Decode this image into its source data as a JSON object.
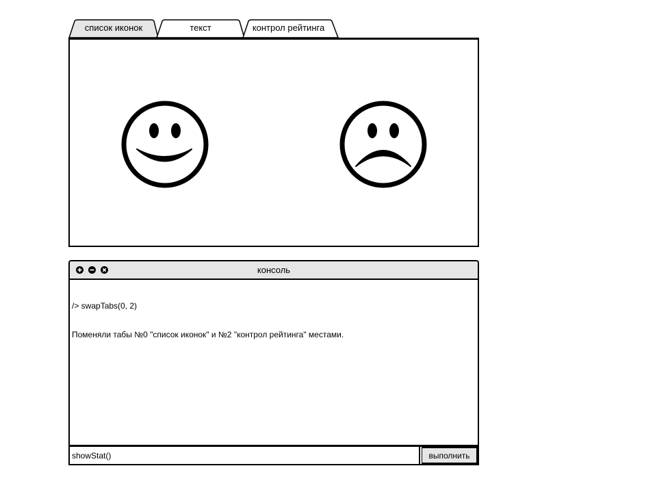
{
  "tabs": [
    {
      "label": "список иконок",
      "active": false,
      "background": "#e6e6e6"
    },
    {
      "label": "текст",
      "active": true,
      "background": "#ffffff"
    },
    {
      "label": "контрол рейтинга",
      "active": false,
      "background": "#ffffff"
    }
  ],
  "panel": {
    "icons": [
      "happy-face-icon",
      "sad-face-icon"
    ]
  },
  "console": {
    "title": "консоль",
    "window_buttons": [
      "plus-icon",
      "minus-icon",
      "close-icon"
    ],
    "output_lines": [
      "/> swapTabs(0, 2)",
      "Поменяли табы №0 \"список иконок\" и №2 \"контрол рейтинга\" местами."
    ],
    "input_value": "showStat()",
    "run_label": "выполнить"
  },
  "colors": {
    "stroke": "#000000",
    "header_bg": "#e6e6e6",
    "panel_bg": "#ffffff"
  }
}
